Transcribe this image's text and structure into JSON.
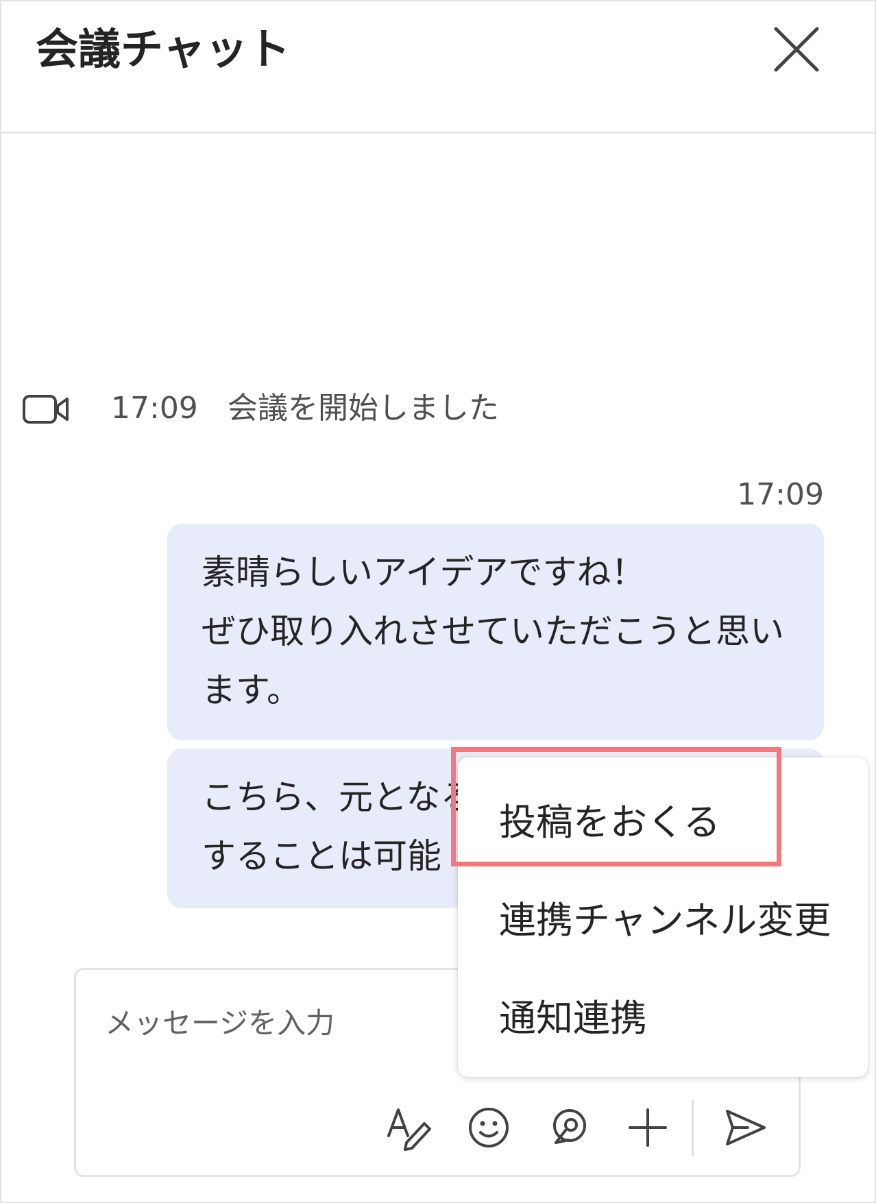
{
  "header": {
    "title": "会議チャット",
    "close_icon": "close-icon"
  },
  "system_message": {
    "icon": "video-camera-icon",
    "time": "17:09",
    "text": "会議を開始しました"
  },
  "messages": [
    {
      "time": "17:09",
      "lines": [
        "素晴らしいアイデアですね！",
        "ぜひ取り入れさせていただこうと思い",
        "ます。"
      ]
    },
    {
      "lines": [
        "こちら、元となる",
        "することは可能"
      ]
    }
  ],
  "context_menu": {
    "items": [
      {
        "label": "投稿をおくる",
        "highlighted": true
      },
      {
        "label": "連携チャンネル変更"
      },
      {
        "label": "通知連携"
      }
    ],
    "highlight_color": "#f2787c"
  },
  "composer": {
    "placeholder": "メッセージを入力",
    "value": "",
    "tools": [
      "format-icon",
      "emoji-icon",
      "loop-icon",
      "plus-icon",
      "send-icon"
    ]
  },
  "colors": {
    "bubble": "#e8ebfa",
    "text": "#242424",
    "secondary_text": "#505050"
  }
}
